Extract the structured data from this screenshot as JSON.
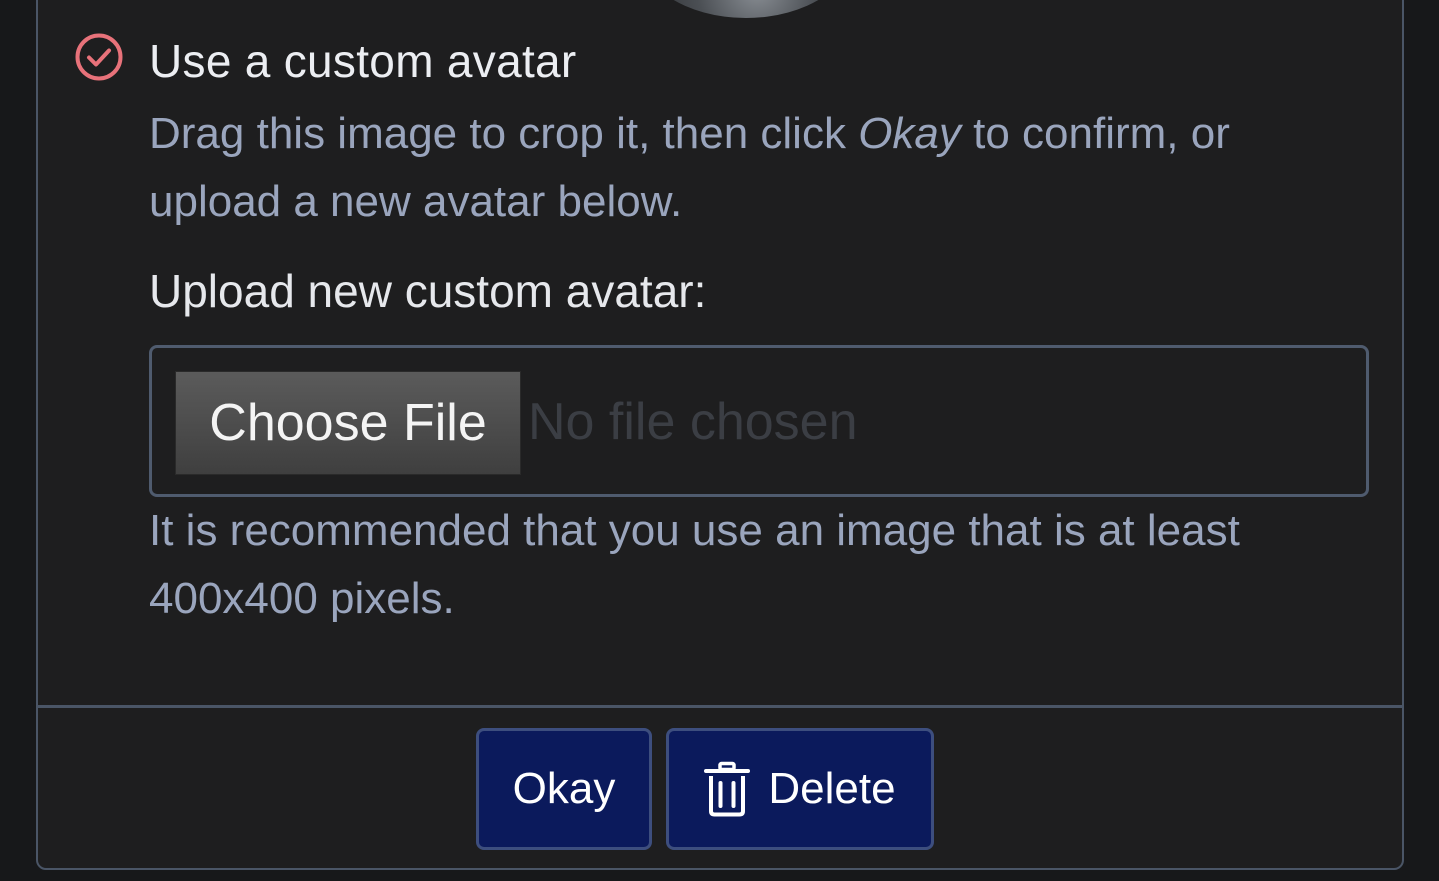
{
  "avatar_option": {
    "title": "Use a custom avatar",
    "icon": "check-circle-icon",
    "description_before": "Drag this image to crop it, then click ",
    "description_emphasis": "Okay",
    "description_after": " to confirm, or upload a new avatar below."
  },
  "upload": {
    "label": "Upload new custom avatar:",
    "choose_button": "Choose File",
    "file_status": "No file chosen",
    "help": "It is recommended that you use an image that is at least 400x400 pixels."
  },
  "footer": {
    "okay_label": "Okay",
    "delete_label": "Delete",
    "delete_icon": "trash-icon"
  },
  "colors": {
    "accent_check": "#e8727a",
    "button_bg": "#0b1a5c",
    "muted_text": "#9aa5bd"
  }
}
